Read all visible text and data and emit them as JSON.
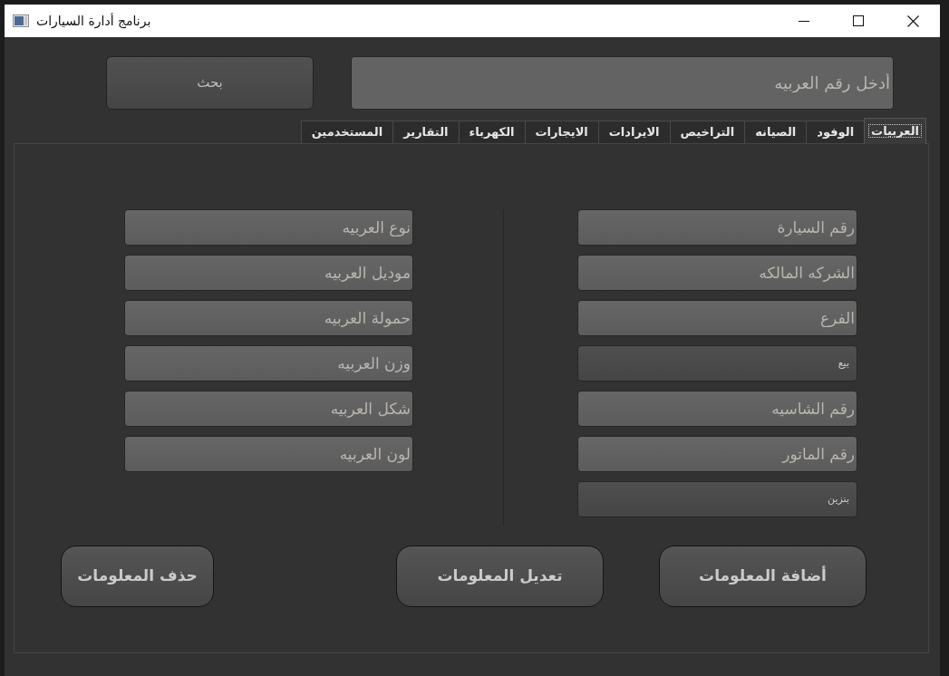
{
  "window": {
    "title": "برنامج أدارة السيارات"
  },
  "search": {
    "placeholder": "أدخل رقم العربيه",
    "button": "بحث"
  },
  "tabs": [
    {
      "label": "العربيات",
      "selected": true
    },
    {
      "label": "الوفود",
      "selected": false
    },
    {
      "label": "الصيانه",
      "selected": false
    },
    {
      "label": "التراخيص",
      "selected": false
    },
    {
      "label": "الايرادات",
      "selected": false
    },
    {
      "label": "الايجارات",
      "selected": false
    },
    {
      "label": "الكهرباء",
      "selected": false
    },
    {
      "label": "التقارير",
      "selected": false
    },
    {
      "label": "المستخدمين",
      "selected": false
    }
  ],
  "form": {
    "right_column": [
      {
        "kind": "input",
        "placeholder": "رقم السيارة"
      },
      {
        "kind": "input",
        "placeholder": "الشركه المالكه"
      },
      {
        "kind": "input",
        "placeholder": "الفرع"
      },
      {
        "kind": "combo",
        "value": "بيع"
      },
      {
        "kind": "input",
        "placeholder": "رقم الشاسيه"
      },
      {
        "kind": "input",
        "placeholder": "رقم الماتور"
      },
      {
        "kind": "combo",
        "value": "بنزين"
      }
    ],
    "left_column": [
      {
        "kind": "input",
        "placeholder": "نوع العربيه"
      },
      {
        "kind": "input",
        "placeholder": "موديل العربيه"
      },
      {
        "kind": "input",
        "placeholder": "حمولة العربيه"
      },
      {
        "kind": "input",
        "placeholder": "وزن العربيه"
      },
      {
        "kind": "input",
        "placeholder": "شكل العربيه"
      },
      {
        "kind": "input",
        "placeholder": "لون العربيه"
      }
    ]
  },
  "actions": [
    "أضافة المعلومات",
    "تعديل المعلومات",
    "حذف المعلومات"
  ]
}
